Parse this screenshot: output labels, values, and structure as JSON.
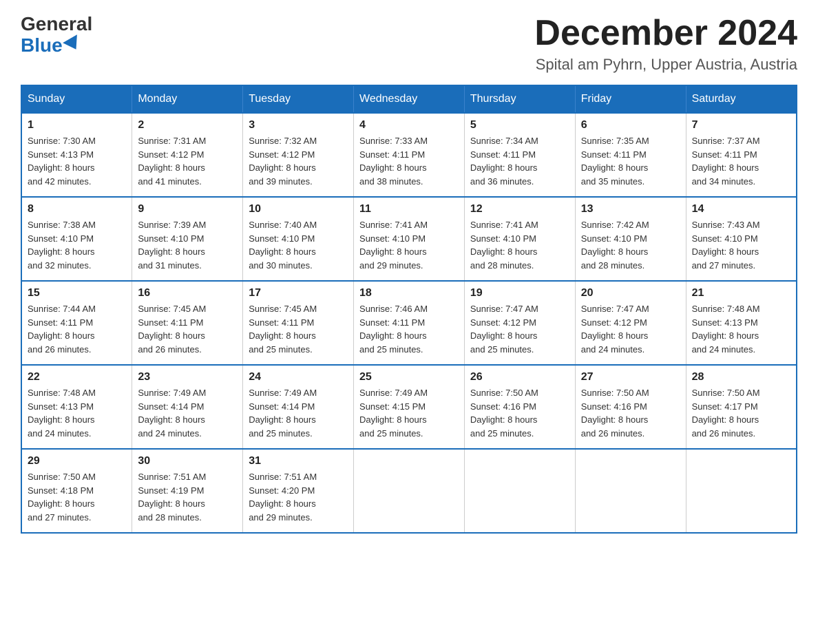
{
  "logo": {
    "general": "General",
    "blue": "Blue"
  },
  "header": {
    "month_year": "December 2024",
    "location": "Spital am Pyhrn, Upper Austria, Austria"
  },
  "weekdays": [
    "Sunday",
    "Monday",
    "Tuesday",
    "Wednesday",
    "Thursday",
    "Friday",
    "Saturday"
  ],
  "weeks": [
    [
      {
        "day": "1",
        "sunrise": "7:30 AM",
        "sunset": "4:13 PM",
        "daylight": "8 hours and 42 minutes."
      },
      {
        "day": "2",
        "sunrise": "7:31 AM",
        "sunset": "4:12 PM",
        "daylight": "8 hours and 41 minutes."
      },
      {
        "day": "3",
        "sunrise": "7:32 AM",
        "sunset": "4:12 PM",
        "daylight": "8 hours and 39 minutes."
      },
      {
        "day": "4",
        "sunrise": "7:33 AM",
        "sunset": "4:11 PM",
        "daylight": "8 hours and 38 minutes."
      },
      {
        "day": "5",
        "sunrise": "7:34 AM",
        "sunset": "4:11 PM",
        "daylight": "8 hours and 36 minutes."
      },
      {
        "day": "6",
        "sunrise": "7:35 AM",
        "sunset": "4:11 PM",
        "daylight": "8 hours and 35 minutes."
      },
      {
        "day": "7",
        "sunrise": "7:37 AM",
        "sunset": "4:11 PM",
        "daylight": "8 hours and 34 minutes."
      }
    ],
    [
      {
        "day": "8",
        "sunrise": "7:38 AM",
        "sunset": "4:10 PM",
        "daylight": "8 hours and 32 minutes."
      },
      {
        "day": "9",
        "sunrise": "7:39 AM",
        "sunset": "4:10 PM",
        "daylight": "8 hours and 31 minutes."
      },
      {
        "day": "10",
        "sunrise": "7:40 AM",
        "sunset": "4:10 PM",
        "daylight": "8 hours and 30 minutes."
      },
      {
        "day": "11",
        "sunrise": "7:41 AM",
        "sunset": "4:10 PM",
        "daylight": "8 hours and 29 minutes."
      },
      {
        "day": "12",
        "sunrise": "7:41 AM",
        "sunset": "4:10 PM",
        "daylight": "8 hours and 28 minutes."
      },
      {
        "day": "13",
        "sunrise": "7:42 AM",
        "sunset": "4:10 PM",
        "daylight": "8 hours and 28 minutes."
      },
      {
        "day": "14",
        "sunrise": "7:43 AM",
        "sunset": "4:10 PM",
        "daylight": "8 hours and 27 minutes."
      }
    ],
    [
      {
        "day": "15",
        "sunrise": "7:44 AM",
        "sunset": "4:11 PM",
        "daylight": "8 hours and 26 minutes."
      },
      {
        "day": "16",
        "sunrise": "7:45 AM",
        "sunset": "4:11 PM",
        "daylight": "8 hours and 26 minutes."
      },
      {
        "day": "17",
        "sunrise": "7:45 AM",
        "sunset": "4:11 PM",
        "daylight": "8 hours and 25 minutes."
      },
      {
        "day": "18",
        "sunrise": "7:46 AM",
        "sunset": "4:11 PM",
        "daylight": "8 hours and 25 minutes."
      },
      {
        "day": "19",
        "sunrise": "7:47 AM",
        "sunset": "4:12 PM",
        "daylight": "8 hours and 25 minutes."
      },
      {
        "day": "20",
        "sunrise": "7:47 AM",
        "sunset": "4:12 PM",
        "daylight": "8 hours and 24 minutes."
      },
      {
        "day": "21",
        "sunrise": "7:48 AM",
        "sunset": "4:13 PM",
        "daylight": "8 hours and 24 minutes."
      }
    ],
    [
      {
        "day": "22",
        "sunrise": "7:48 AM",
        "sunset": "4:13 PM",
        "daylight": "8 hours and 24 minutes."
      },
      {
        "day": "23",
        "sunrise": "7:49 AM",
        "sunset": "4:14 PM",
        "daylight": "8 hours and 24 minutes."
      },
      {
        "day": "24",
        "sunrise": "7:49 AM",
        "sunset": "4:14 PM",
        "daylight": "8 hours and 25 minutes."
      },
      {
        "day": "25",
        "sunrise": "7:49 AM",
        "sunset": "4:15 PM",
        "daylight": "8 hours and 25 minutes."
      },
      {
        "day": "26",
        "sunrise": "7:50 AM",
        "sunset": "4:16 PM",
        "daylight": "8 hours and 25 minutes."
      },
      {
        "day": "27",
        "sunrise": "7:50 AM",
        "sunset": "4:16 PM",
        "daylight": "8 hours and 26 minutes."
      },
      {
        "day": "28",
        "sunrise": "7:50 AM",
        "sunset": "4:17 PM",
        "daylight": "8 hours and 26 minutes."
      }
    ],
    [
      {
        "day": "29",
        "sunrise": "7:50 AM",
        "sunset": "4:18 PM",
        "daylight": "8 hours and 27 minutes."
      },
      {
        "day": "30",
        "sunrise": "7:51 AM",
        "sunset": "4:19 PM",
        "daylight": "8 hours and 28 minutes."
      },
      {
        "day": "31",
        "sunrise": "7:51 AM",
        "sunset": "4:20 PM",
        "daylight": "8 hours and 29 minutes."
      },
      null,
      null,
      null,
      null
    ]
  ],
  "labels": {
    "sunrise": "Sunrise:",
    "sunset": "Sunset:",
    "daylight": "Daylight:"
  }
}
